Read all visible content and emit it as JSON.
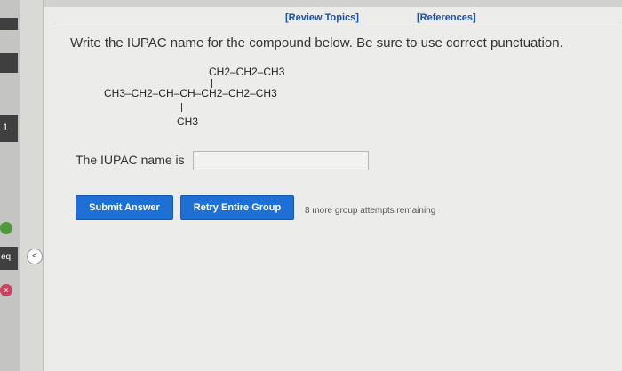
{
  "sidebar": {
    "item3_label": "1",
    "item4_label": "eq",
    "circle1_icon": "status-circle-green-icon",
    "circle2_icon": "close-circle-icon"
  },
  "header": {
    "review_link": "[Review Topics]",
    "references_link": "[References]"
  },
  "question": {
    "prompt": "Write the IUPAC name for the compound below. Be sure to use correct punctuation.",
    "structure_top": "CH2–CH2–CH3",
    "structure_main": "CH3–CH2–CH–CH–CH2–CH2–CH3",
    "structure_bottom": "CH3"
  },
  "answer": {
    "label": "The IUPAC name is",
    "value": "",
    "placeholder": ""
  },
  "buttons": {
    "submit_label": "Submit Answer",
    "retry_label": "Retry Entire Group"
  },
  "status": {
    "remaining_text": "8 more group attempts remaining"
  },
  "colors": {
    "button_blue": "#1e6fd6",
    "link_blue": "#1a4fa8",
    "panel_bg": "#ececea"
  }
}
